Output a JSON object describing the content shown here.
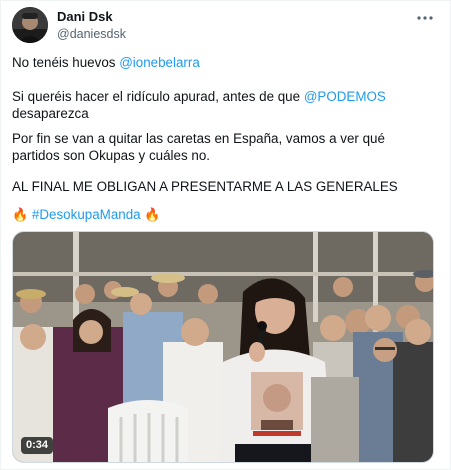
{
  "author": {
    "display_name": "Dani Dsk",
    "handle": "@daniesdsk"
  },
  "more_icon": "more-dots-icon",
  "tweet": {
    "line1_text": "No tenéis huevos ",
    "line1_mention": "@ionebelarra",
    "line2_text": "Si queréis hacer el ridículo apurad, antes de que ",
    "line2_mention": "@PODEMOS",
    "line2_tail": " desaparezca",
    "line3_text": "Por fin se van a quitar las caretas en España, vamos a ver qué partidos son Okupas y cuáles no.",
    "line4_text": "AL FINAL ME OBLIGAN A PRESENTARME A LAS GENERALES",
    "fire_emoji": "🔥",
    "hashtag": "#DesokupaManda"
  },
  "media": {
    "type": "video",
    "duration": "0:34"
  },
  "colors": {
    "link": "#1d9bf0",
    "text": "#0f1419",
    "secondary": "#536471"
  }
}
